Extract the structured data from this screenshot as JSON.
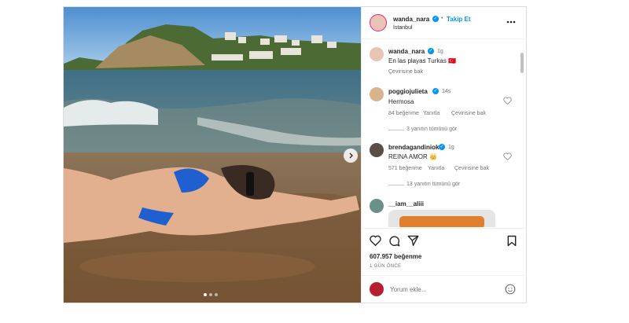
{
  "post": {
    "carousel": {
      "slides": 3,
      "active": 0
    },
    "header": {
      "username": "wanda_nara",
      "separator": "•",
      "follow_label": "Takip Et",
      "location": "İstanbul"
    },
    "caption": {
      "username": "wanda_nara",
      "time": "1g",
      "text": "En las playas Turkas 🇹🇷",
      "translate_label": "Çevirisine bak"
    },
    "comments": [
      {
        "username": "poggiojulieta",
        "time": "14s",
        "text": "Hermosa",
        "likes": "84 beğenme",
        "reply_label": "Yanıtla",
        "translate_label": "Çevirisine bak",
        "view_replies": "3 yanıtın tümünü gör"
      },
      {
        "username": "brendagandiniok",
        "time": "1g",
        "text": "REINA AMOR 👑",
        "likes": "571 beğenme",
        "reply_label": "Yanıtla",
        "translate_label": "Çevirisine bak",
        "view_replies": "13 yanıtın tümünü gör"
      },
      {
        "username": "__iam__aliii",
        "time": "",
        "text": ""
      }
    ],
    "likes_count": "607.957 beğenme",
    "posted": "1 GÜN ÖNCE",
    "comment_placeholder": "Yorum ekle...",
    "colors": {
      "link": "#0095f6",
      "verified": "#0095f6",
      "muted": "#737373",
      "border": "#dbdbdb"
    },
    "icons": [
      "chevron-right-icon",
      "more-icon",
      "heart-icon",
      "comment-icon",
      "share-icon",
      "bookmark-icon",
      "emoji-icon",
      "verified-icon"
    ]
  }
}
